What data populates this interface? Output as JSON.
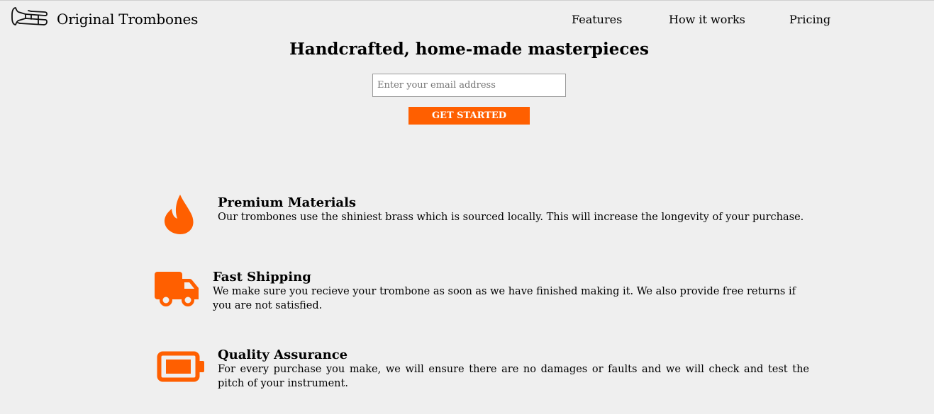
{
  "header": {
    "logo_text": "Original Trombones",
    "nav": [
      {
        "label": "Features"
      },
      {
        "label": "How it works"
      },
      {
        "label": "Pricing"
      }
    ]
  },
  "hero": {
    "title": "Handcrafted, home-made masterpieces",
    "email_placeholder": "Enter your email address",
    "cta_label": "GET STARTED"
  },
  "features": [
    {
      "icon": "fire-icon",
      "title": "Premium Materials",
      "description": "Our trombones use the shiniest brass which is sourced locally. This will increase the longevity of your purchase."
    },
    {
      "icon": "truck-icon",
      "title": "Fast Shipping",
      "description": "We make sure you recieve your trombone as soon as we have finished making it. We also provide free returns if you are not satisfied."
    },
    {
      "icon": "battery-full-icon",
      "title": "Quality Assurance",
      "description": "For every purchase you make, we will ensure there are no damages or faults and we will check and test the pitch of your instrument."
    }
  ],
  "colors": {
    "accent": "#ff5f00",
    "background": "#efefef"
  }
}
